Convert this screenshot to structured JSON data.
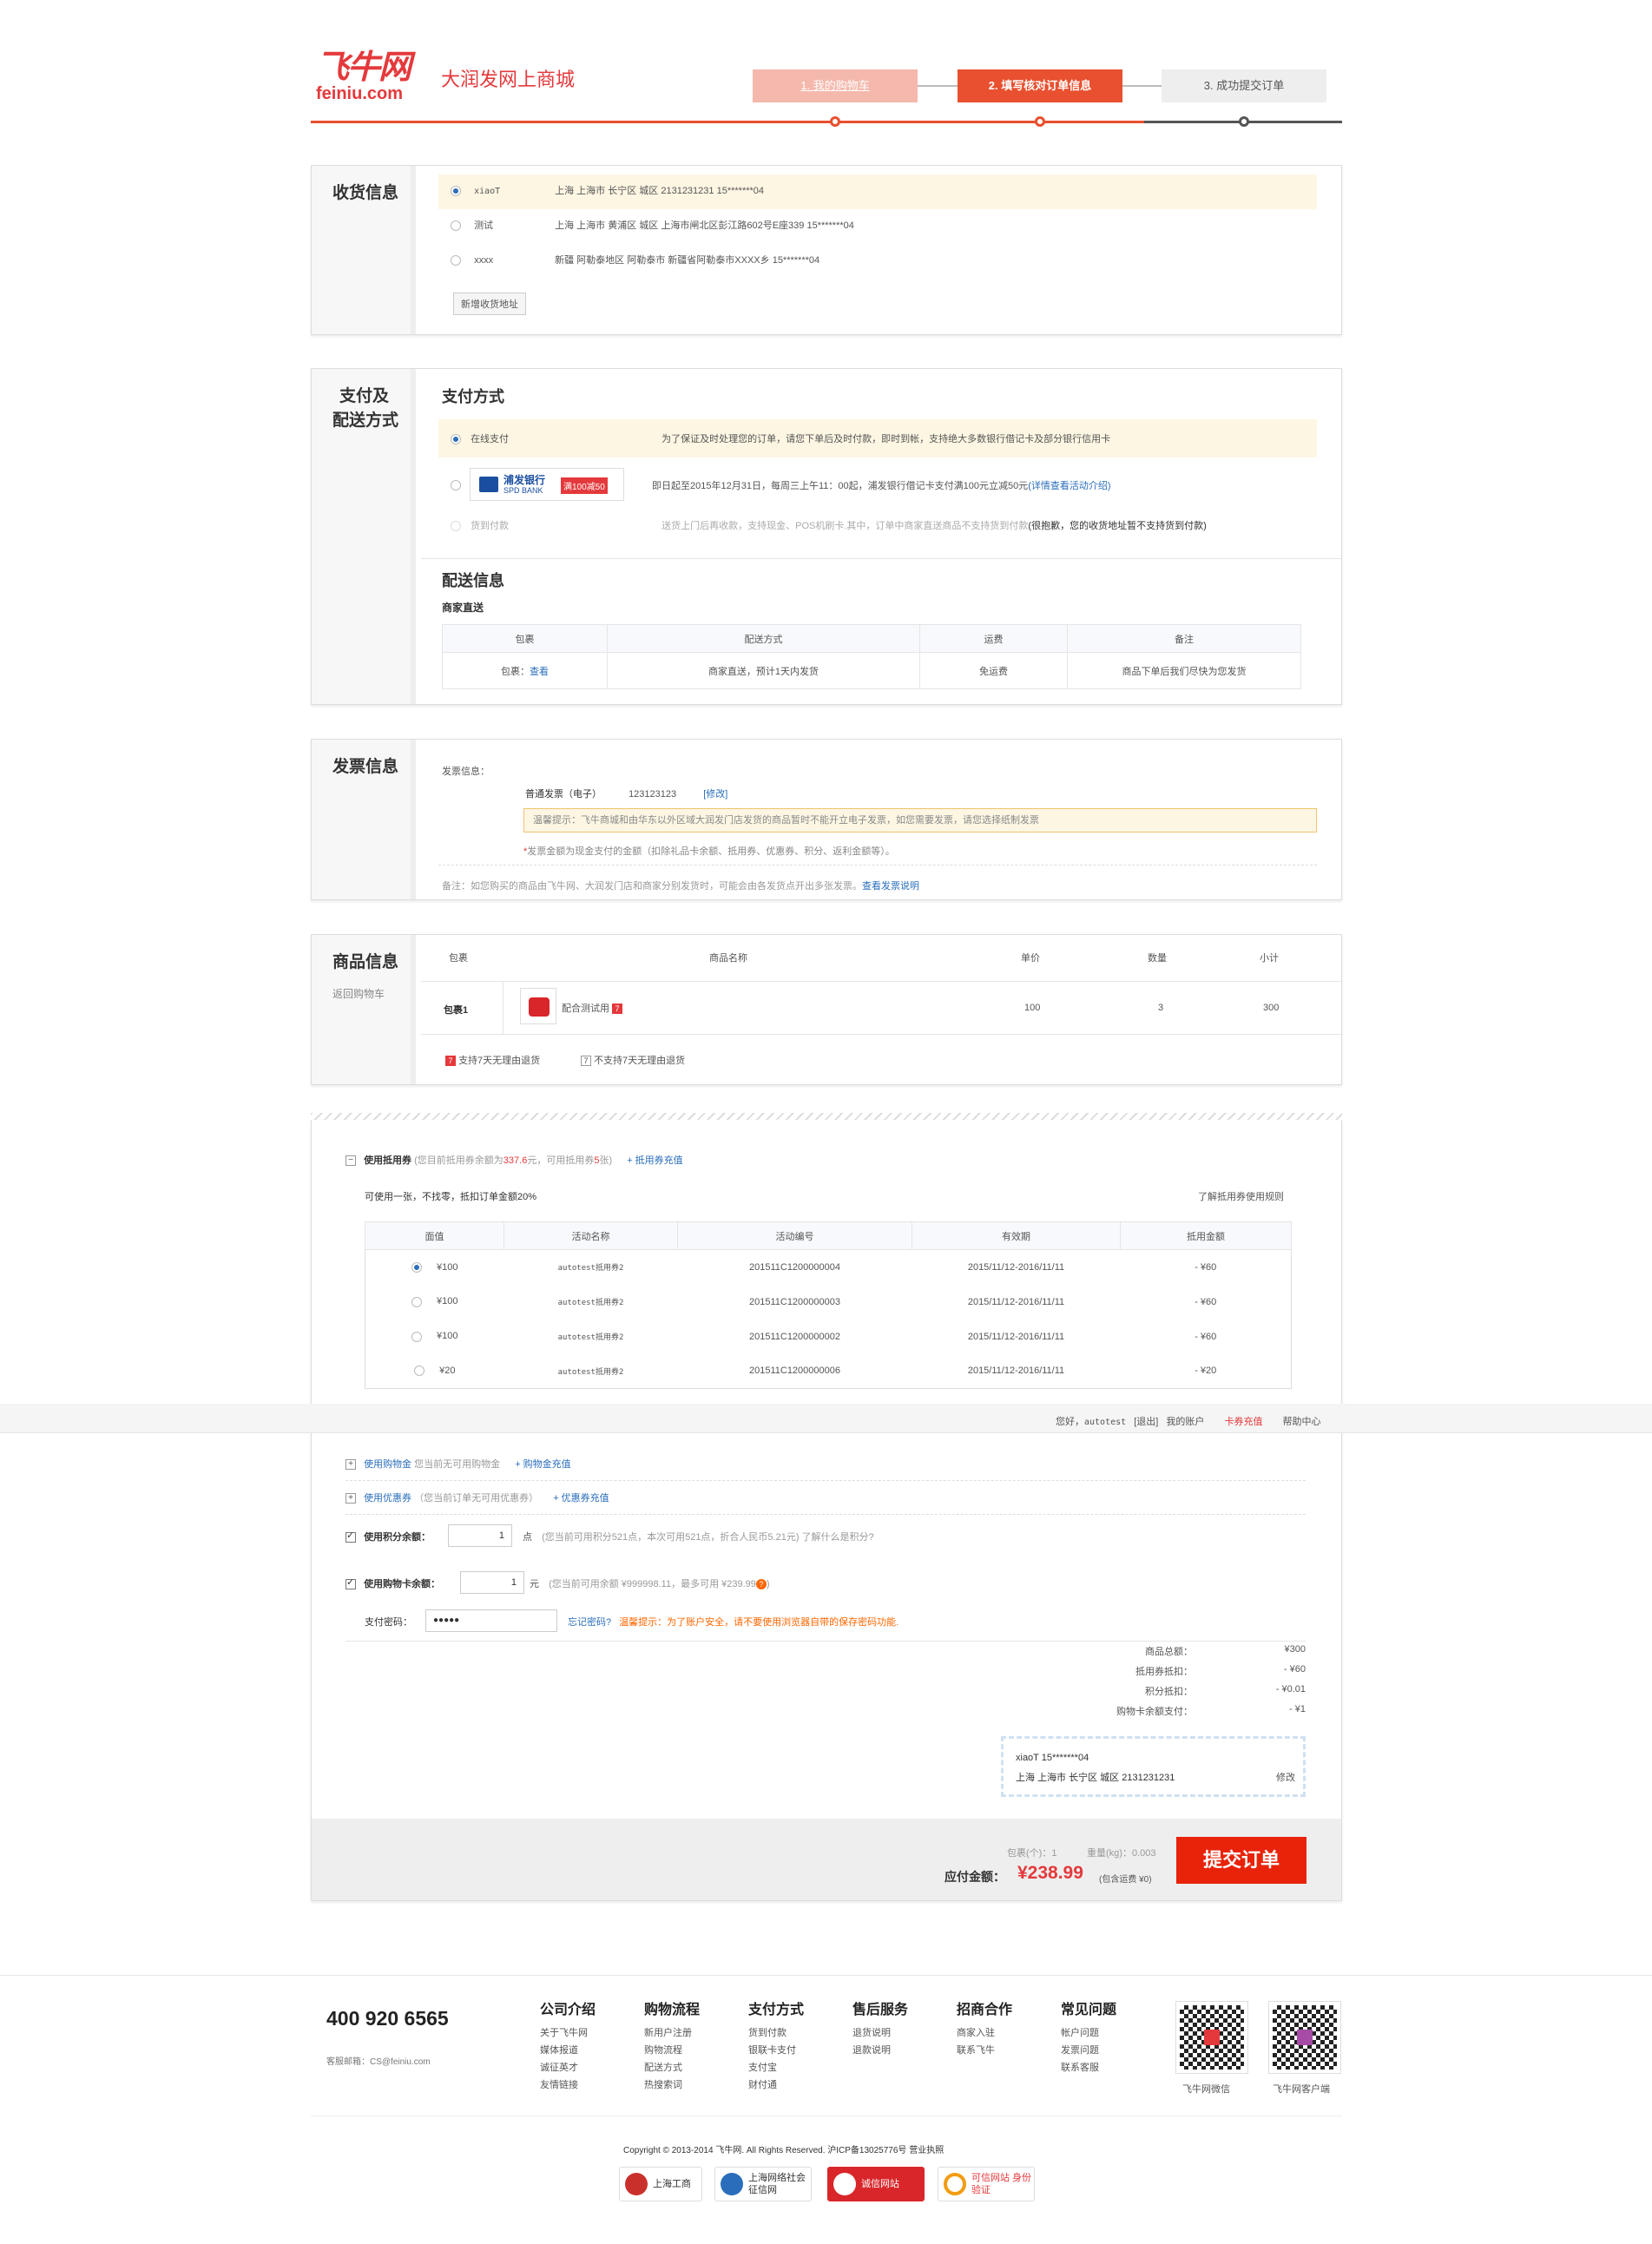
{
  "header": {
    "logo_cn": "飞牛网",
    "logo_en": "feiniu.com",
    "slogan": "大润发网上商城",
    "steps": [
      "1. 我的购物车",
      "2. 填写核对订单信息",
      "3. 成功提交订单"
    ]
  },
  "address": {
    "title": "收货信息",
    "add_label": "新增收货地址",
    "items": [
      {
        "name": "xiaoT",
        "detail": "上海 上海市 长宁区 城区 2131231231 15*******04",
        "selected": true
      },
      {
        "name": "测试",
        "detail": "上海 上海市 黄浦区 城区 上海市闸北区彭江路602号E座339 15*******04",
        "selected": false
      },
      {
        "name": "xxxx",
        "detail": "新疆 阿勒泰地区 阿勒泰市 新疆省阿勒泰市XXXX乡 15*******04",
        "selected": false
      }
    ]
  },
  "payment": {
    "title_line1": "支付及",
    "title_line2": "配送方式",
    "sub": "支付方式",
    "online": "在线支付",
    "online_desc": "为了保证及时处理您的订单，请您下单后及时付款，即时到帐，支持绝大多数银行借记卡及部分银行信用卡",
    "bank_cn": "浦发银行",
    "bank_en": "SPD BANK",
    "bank_promo": "满100减50",
    "bank_desc": "即日起至2015年12月31日，每周三上午11：00起，浦发银行借记卡支付满100元立减50元",
    "bank_link": "(详情查看活动介绍)",
    "cod": "货到付款",
    "cod_desc": "送货上门后再收款，支持现金、POS机刷卡.其中，订单中商家直送商品不支持货到付款",
    "cod_warn": "(很抱歉，您的收货地址暂不支持货到付款)"
  },
  "delivery": {
    "title": "配送信息",
    "merchant": "商家直送",
    "headers": [
      "包裹",
      "配送方式",
      "运费",
      "备注"
    ],
    "pkg_label": "包裹：",
    "pkg_link": "查看",
    "method": "商家直送，预计1天内发货",
    "fee": "免运费",
    "note": "商品下单后我们尽快为您发货"
  },
  "invoice": {
    "title": "发票信息",
    "label": "发票信息：",
    "type": "普通发票（电子）",
    "number": "123123123",
    "edit": "[修改]",
    "tip": "温馨提示：飞牛商城和由华东以外区域大润发门店发货的商品暂时不能开立电子发票，如您需要发票，请您选择纸制发票",
    "note1": "发票金额为现金支付的金额（扣除礼品卡余额、抵用券、优惠券、积分、返利金额等）。",
    "note2": "备注：如您购买的商品由飞牛网、大润发门店和商家分别发货时，可能会由各发货点开出多张发票。",
    "note2_link": "查看发票说明"
  },
  "goods": {
    "title": "商品信息",
    "back": "返回购物车",
    "headers": [
      "包裹",
      "商品名称",
      "单价",
      "数量",
      "小计"
    ],
    "pkg": "包裹1",
    "name": "配合测试用",
    "price": "100",
    "qty": "3",
    "subtotal": "300",
    "support": "支持7天无理由退货",
    "nosupport": "不支持7天无理由退货"
  },
  "coupon": {
    "title": "使用抵用券",
    "balance_pre": "(您目前抵用券余额为",
    "balance": "337.6",
    "balance_mid": "元，可用抵用券",
    "count": "5",
    "balance_post": "张)",
    "recharge": "+ 抵用券充值",
    "rule": "可使用一张，不找零，抵扣订单金额20%",
    "learn": "了解抵用券使用规则",
    "headers": [
      "面值",
      "活动名称",
      "活动编号",
      "有效期",
      "抵用金额"
    ],
    "rows": [
      {
        "value": "¥100",
        "name": "autotest抵用券2",
        "code": "201511C1200000004",
        "period": "2015/11/12-2016/11/11",
        "amount": "- ¥60",
        "selected": true
      },
      {
        "value": "¥100",
        "name": "autotest抵用券2",
        "code": "201511C1200000003",
        "period": "2015/11/12-2016/11/11",
        "amount": "- ¥60",
        "selected": false
      },
      {
        "value": "¥100",
        "name": "autotest抵用券2",
        "code": "201511C1200000002",
        "period": "2015/11/12-2016/11/11",
        "amount": "- ¥60",
        "selected": false
      },
      {
        "value": "¥20",
        "name": "autotest抵用券2",
        "code": "201511C1200000006",
        "period": "2015/11/12-2016/11/11",
        "amount": "- ¥20",
        "selected": false
      }
    ]
  },
  "topbar": {
    "hello": "您好，",
    "user": "autotest",
    "logout": "[退出]",
    "account": "我的账户",
    "card": "卡券充值",
    "help": "帮助中心"
  },
  "options": {
    "gold": "使用购物金",
    "gold_desc": "您当前无可用购物金",
    "gold_link": "+ 购物金充值",
    "promo": "使用优惠券",
    "promo_desc": "（您当前订单无可用优惠券）",
    "promo_link": "+ 优惠券充值",
    "points": "使用积分余额：",
    "points_val": "1",
    "points_unit": "点",
    "points_desc": "(您当前可用积分521点，本次可用521点，折合人民币5.21元) 了解什么是积分?",
    "card": "使用购物卡余额：",
    "card_val": "1",
    "card_unit": "元",
    "card_desc": "(您当前可用余额 ¥999998.11，最多可用 ¥239.99",
    "pwd_label": "支付密码：",
    "pwd_val": "●●●●●",
    "forgot": "忘记密码?",
    "pwd_tip": "温馨提示：为了账户安全，请不要使用浏览器自带的保存密码功能."
  },
  "summary": {
    "rows": [
      {
        "k": "商品总额：",
        "v": "¥300"
      },
      {
        "k": "抵用券抵扣：",
        "v": "- ¥60"
      },
      {
        "k": "积分抵扣：",
        "v": "- ¥0.01"
      },
      {
        "k": "购物卡余额支付：",
        "v": "- ¥1"
      }
    ],
    "addr_name": "xiaoT 15*******04",
    "addr_detail": "上海 上海市 长宁区 城区 2131231231",
    "addr_edit": "修改",
    "pkg_count": "包裹(个)：1",
    "weight": "重量(kg)：0.003",
    "pay_label": "应付金额：",
    "pay": "¥238.99",
    "pay_note": "(包含运费 ¥0)",
    "submit": "提交订单"
  },
  "footer": {
    "phone": "400 920 6565",
    "email": "客服邮箱：CS@feiniu.com",
    "cols": [
      {
        "title": "公司介绍",
        "items": [
          "关于飞牛网",
          "媒体报道",
          "诚征英才",
          "友情链接"
        ]
      },
      {
        "title": "购物流程",
        "items": [
          "新用户注册",
          "购物流程",
          "配送方式",
          "热搜索词"
        ]
      },
      {
        "title": "支付方式",
        "items": [
          "货到付款",
          "银联卡支付",
          "支付宝",
          "财付通"
        ]
      },
      {
        "title": "售后服务",
        "items": [
          "退货说明",
          "退款说明"
        ]
      },
      {
        "title": "招商合作",
        "items": [
          "商家入驻",
          "联系飞牛"
        ]
      },
      {
        "title": "常见问题",
        "items": [
          "帐户问题",
          "发票问题",
          "联系客服"
        ]
      }
    ],
    "qr1": "飞牛网微信",
    "qr2": "飞牛网客户端",
    "copyright": "Copyright © 2013-2014 飞牛网. All Rights Reserved. 沪ICP备13025776号 营业执照",
    "badges": [
      "上海工商",
      "上海网络社会征信网",
      "诚信网站",
      "可信网站 身份验证"
    ]
  },
  "colors": {
    "brand": "#e4393c",
    "link": "#2a6ebb",
    "step_done": "#f5b8ac",
    "step_active": "#e8502f"
  }
}
